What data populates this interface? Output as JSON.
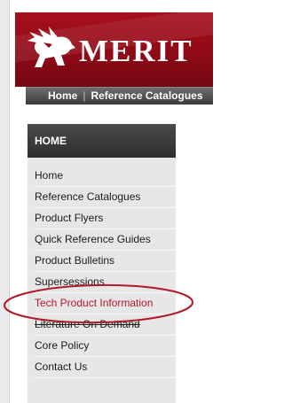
{
  "header": {
    "brand_text": "MERIT",
    "logo_icon": "winged-horse-logo-icon",
    "colors": {
      "brand_red": "#8f0a16",
      "nav_dark": "#4a4a4a",
      "highlight": "#b2182b"
    }
  },
  "topnav": {
    "items": [
      {
        "label": "Home"
      },
      {
        "separator": "|"
      },
      {
        "label": "Reference Catalogues"
      }
    ]
  },
  "sidebar": {
    "title": "HOME",
    "items": [
      {
        "label": "Home"
      },
      {
        "label": "Reference Catalogues"
      },
      {
        "label": "Product Flyers"
      },
      {
        "label": "Quick Reference Guides"
      },
      {
        "label": "Product Bulletins"
      },
      {
        "label": "Supersessions"
      },
      {
        "label": "Tech Product Information",
        "highlighted": true
      },
      {
        "label": "Literature On Demand"
      },
      {
        "label": "Core Policy"
      },
      {
        "label": "Contact Us"
      }
    ]
  }
}
